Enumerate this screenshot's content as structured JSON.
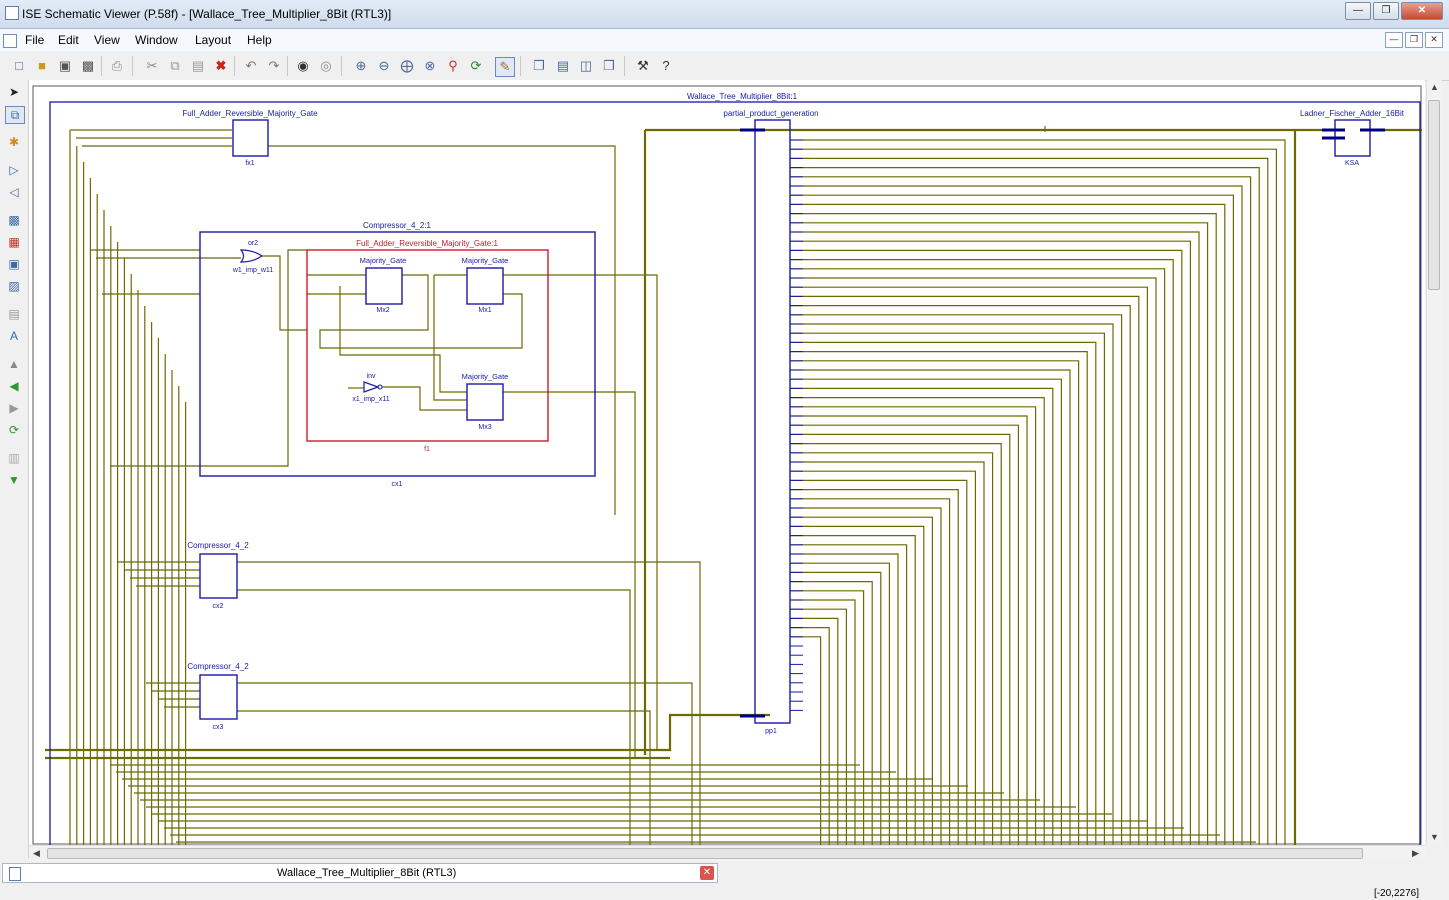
{
  "window": {
    "title": "ISE Schematic Viewer (P.58f) - [Wallace_Tree_Multiplier_8Bit (RTL3)]"
  },
  "menu": [
    "File",
    "Edit",
    "View",
    "Window",
    "Layout",
    "Help"
  ],
  "schematic": {
    "top_title": "Wallace_Tree_Multiplier_8Bit:1",
    "fa_top": {
      "title": "Full_Adder_Reversible_Majority_Gate",
      "inst": "fx1"
    },
    "pp": {
      "title": "partial_product_generation",
      "inst": "pp1"
    },
    "ksa": {
      "title": "Ladner_Fischer_Adder_16Bit",
      "inst": "KSA"
    },
    "compressor1": {
      "title": "Compressor_4_2:1",
      "inst": "cx1"
    },
    "fa_inner": {
      "title": "Full_Adder_Reversible_Majority_Gate:1",
      "inst": "f1"
    },
    "or_gate": {
      "title": "or2",
      "inst": "w1_imp_w11"
    },
    "mg1": {
      "title": "Majority_Gate",
      "inst": "Mx2"
    },
    "mg2": {
      "title": "Majority_Gate",
      "inst": "Mx1"
    },
    "mg3": {
      "title": "Majority_Gate",
      "inst": "Mx3"
    },
    "inv": {
      "title": "inv",
      "inst": "x1_imp_x11"
    },
    "compressor2": {
      "title": "Compressor_4_2",
      "inst": "cx2"
    },
    "compressor3": {
      "title": "Compressor_4_2",
      "inst": "cx3"
    }
  },
  "tab": {
    "label": "Wallace_Tree_Multiplier_8Bit (RTL3)"
  },
  "status": {
    "coords": "[-20,2276]"
  },
  "colors": {
    "wire": "#6b6b00",
    "block": "#1a1aa8",
    "highlight": "#cc1a2a",
    "bus": "#000080"
  }
}
